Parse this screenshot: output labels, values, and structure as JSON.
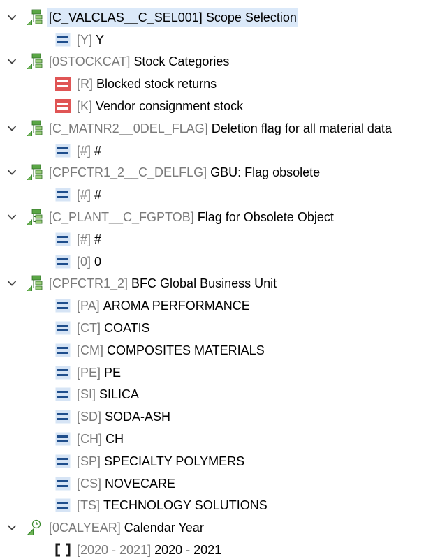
{
  "tree": [
    {
      "code": "[C_VALCLAS__C_SEL001]",
      "label": "Scope Selection",
      "icon": "hierarchy-icon",
      "selected": true,
      "children": [
        {
          "code": "[Y]",
          "label": "Y",
          "icon": "equals-icon"
        }
      ]
    },
    {
      "code": "[0STOCKCAT]",
      "label": "Stock Categories",
      "icon": "hierarchy-icon",
      "children": [
        {
          "code": "[R]",
          "label": "Blocked stock returns",
          "icon": "exclude-icon"
        },
        {
          "code": "[K]",
          "label": "Vendor consignment stock",
          "icon": "exclude-icon"
        }
      ]
    },
    {
      "code": "[C_MATNR2__0DEL_FLAG]",
      "label": "Deletion flag for all material data",
      "icon": "hierarchy-icon",
      "children": [
        {
          "code": "[#]",
          "label": "#",
          "icon": "equals-icon"
        }
      ]
    },
    {
      "code": "[CPFCTR1_2__C_DELFLG]",
      "label": "GBU: Flag obsolete",
      "icon": "hierarchy-icon",
      "children": [
        {
          "code": "[#]",
          "label": "#",
          "icon": "equals-icon"
        }
      ]
    },
    {
      "code": "[C_PLANT__C_FGPTOB]",
      "label": "Flag for Obsolete Object",
      "icon": "hierarchy-icon",
      "children": [
        {
          "code": "[#]",
          "label": "#",
          "icon": "equals-icon"
        },
        {
          "code": "[0]",
          "label": "0",
          "icon": "equals-icon"
        }
      ]
    },
    {
      "code": "[CPFCTR1_2]",
      "label": "BFC Global Business Unit",
      "icon": "hierarchy-icon",
      "children": [
        {
          "code": "[PA]",
          "label": "AROMA PERFORMANCE",
          "icon": "equals-icon"
        },
        {
          "code": "[CT]",
          "label": "COATIS",
          "icon": "equals-icon"
        },
        {
          "code": "[CM]",
          "label": "COMPOSITES MATERIALS",
          "icon": "equals-icon"
        },
        {
          "code": "[PE]",
          "label": "PE",
          "icon": "equals-icon"
        },
        {
          "code": "[SI]",
          "label": "SILICA",
          "icon": "equals-icon"
        },
        {
          "code": "[SD]",
          "label": "SODA-ASH",
          "icon": "equals-icon"
        },
        {
          "code": "[CH]",
          "label": "CH",
          "icon": "equals-icon"
        },
        {
          "code": "[SP]",
          "label": "SPECIALTY POLYMERS",
          "icon": "equals-icon"
        },
        {
          "code": "[CS]",
          "label": "NOVECARE",
          "icon": "equals-icon"
        },
        {
          "code": "[TS]",
          "label": "TECHNOLOGY SOLUTIONS",
          "icon": "equals-icon"
        }
      ]
    },
    {
      "code": "[0CALYEAR]",
      "label": "Calendar Year",
      "icon": "time-hierarchy-icon",
      "children": [
        {
          "code": "[2020 - 2021]",
          "label": "2020 - 2021",
          "icon": "interval-icon"
        }
      ]
    }
  ],
  "colors": {
    "selection_bg": "#dbe9f9",
    "code_text": "#7a7a7a",
    "equals_icon": "#1f4e8c",
    "equals_bg": "#d6e4f5",
    "exclude_icon": "#e05555",
    "hierarchy_green": "#3a8a2e"
  }
}
